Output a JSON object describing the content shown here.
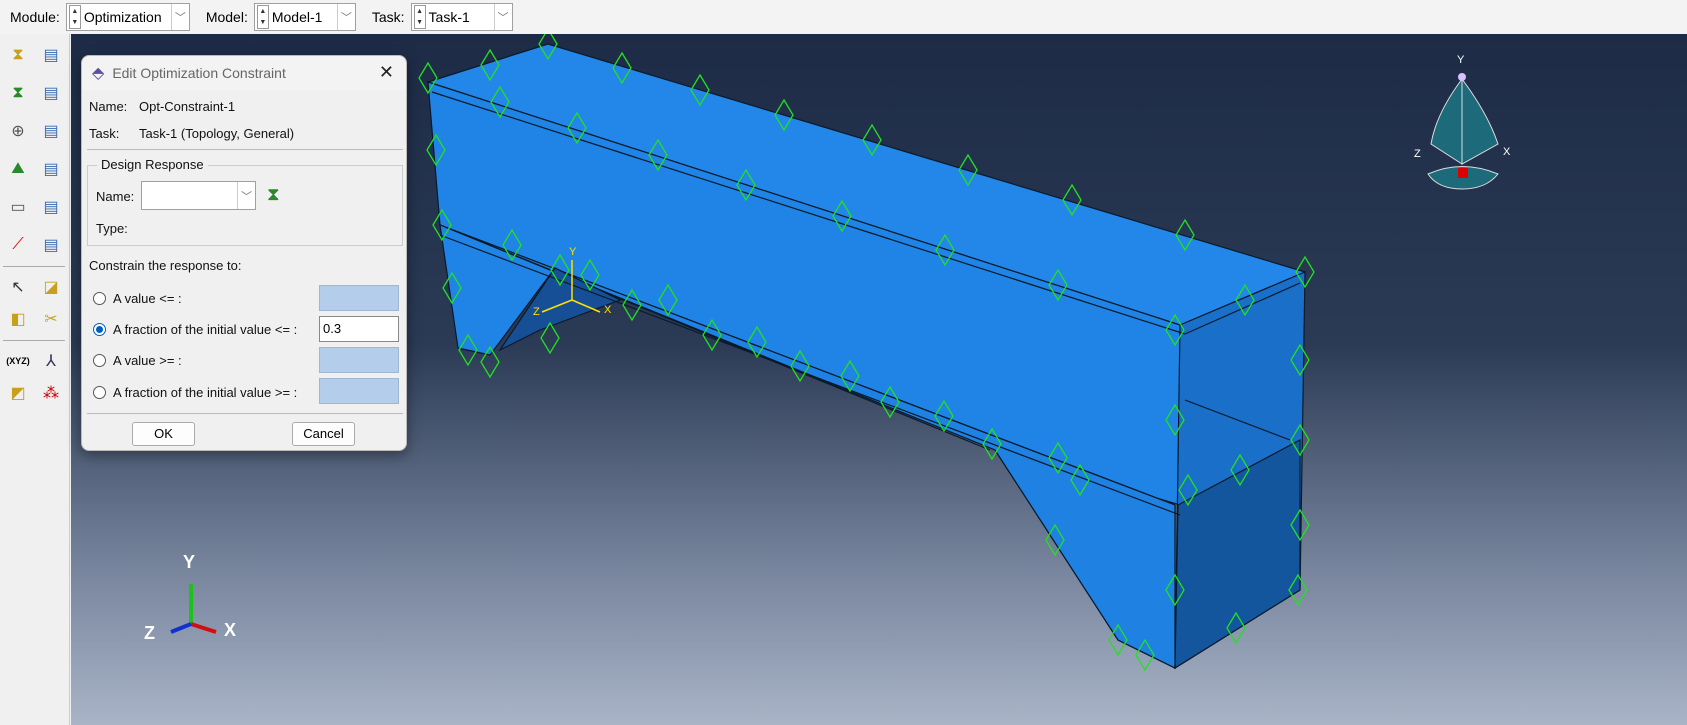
{
  "topbar": {
    "module_label": "Module:",
    "module_value": "Optimization",
    "model_label": "Model:",
    "model_value": "Model-1",
    "task_label": "Task:",
    "task_value": "Task-1"
  },
  "toolbox": {
    "tools": [
      "create-design-response",
      "design-response-manager",
      "create-objective-function",
      "objective-function-manager",
      "create-constraint",
      "constraint-manager",
      "create-geometric-restriction",
      "geometric-restriction-manager",
      "create-stop-condition",
      "stop-condition-manager",
      "create-datum",
      "datum-manager",
      "query",
      "partition",
      "attributes",
      "cut",
      "datum-csys",
      "datum-axis",
      "datum-plane",
      "datum-point"
    ]
  },
  "dialog": {
    "title": "Edit Optimization Constraint",
    "name_label": "Name:",
    "name_value": "Opt-Constraint-1",
    "task_label": "Task:",
    "task_value": "Task-1 (Topology, General)",
    "design_response": {
      "group_label": "Design Response",
      "name_label": "Name:",
      "name_value": "",
      "type_label": "Type:"
    },
    "constrain_label": "Constrain the response to:",
    "options": [
      {
        "label": "A value <= :",
        "value": "",
        "selected": false,
        "enabled": false
      },
      {
        "label": "A fraction of the initial value <= :",
        "value": "0.3",
        "selected": true,
        "enabled": true
      },
      {
        "label": "A value >= :",
        "value": "",
        "selected": false,
        "enabled": false
      },
      {
        "label": "A fraction of the initial value >= :",
        "value": "",
        "selected": false,
        "enabled": false
      }
    ],
    "ok_label": "OK",
    "cancel_label": "Cancel"
  },
  "viewport": {
    "local_csys": {
      "x": "X",
      "y": "Y",
      "z": "Z"
    },
    "triad": {
      "x": "X",
      "y": "Y",
      "z": "Z"
    },
    "view_cube": {
      "x": "X",
      "y": "Y",
      "z": "Z"
    },
    "colors": {
      "part": "#1f84e6",
      "part_dark": "#1560b0",
      "bc_marker": "#22e022",
      "background_top": "#1d2b46",
      "background_bottom": "#a9b4c7"
    }
  }
}
